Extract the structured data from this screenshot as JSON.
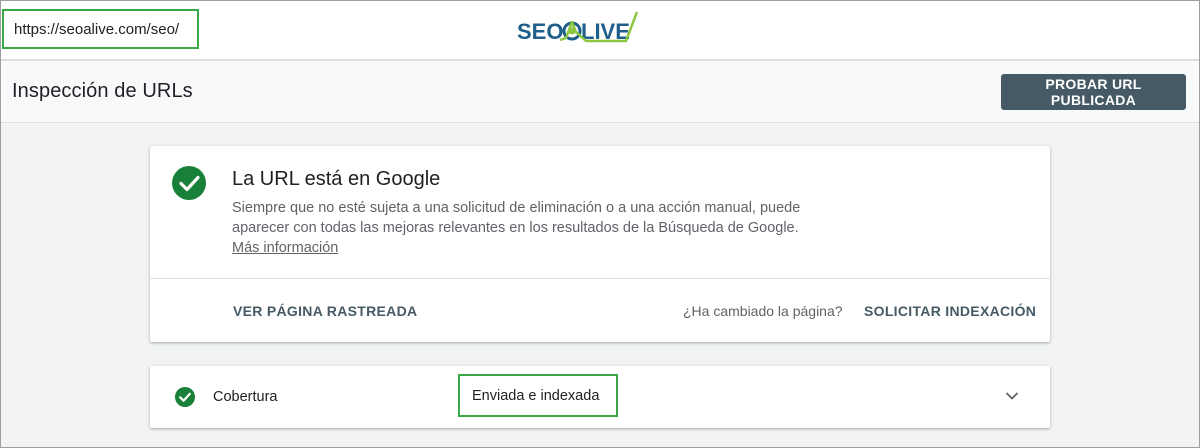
{
  "topbar": {
    "url": "https://seoalive.com/seo/",
    "logo_text": "SEOALIVE"
  },
  "header": {
    "title": "Inspección de URLs",
    "test_live_button": "PROBAR URL PUBLICADA"
  },
  "status_card": {
    "title": "La URL está en Google",
    "description": "Siempre que no esté sujeta a una solicitud de eliminación o a una acción manual, puede aparecer con todas las mejoras relevantes en los resultados de la Búsqueda de Google.",
    "more_info": "Más información",
    "view_crawled": "VER PÁGINA RASTREADA",
    "changed_question": "¿Ha cambiado la página?",
    "request_indexing": "SOLICITAR INDEXACIÓN"
  },
  "coverage": {
    "label": "Cobertura",
    "status": "Enviada e indexada"
  },
  "colors": {
    "success_green": "#188038",
    "highlight_green": "#3aa845",
    "button_bg": "#455a64",
    "logo_blue": "#1f5f8b"
  },
  "icons": [
    "check-circle-icon",
    "chevron-down-icon"
  ]
}
